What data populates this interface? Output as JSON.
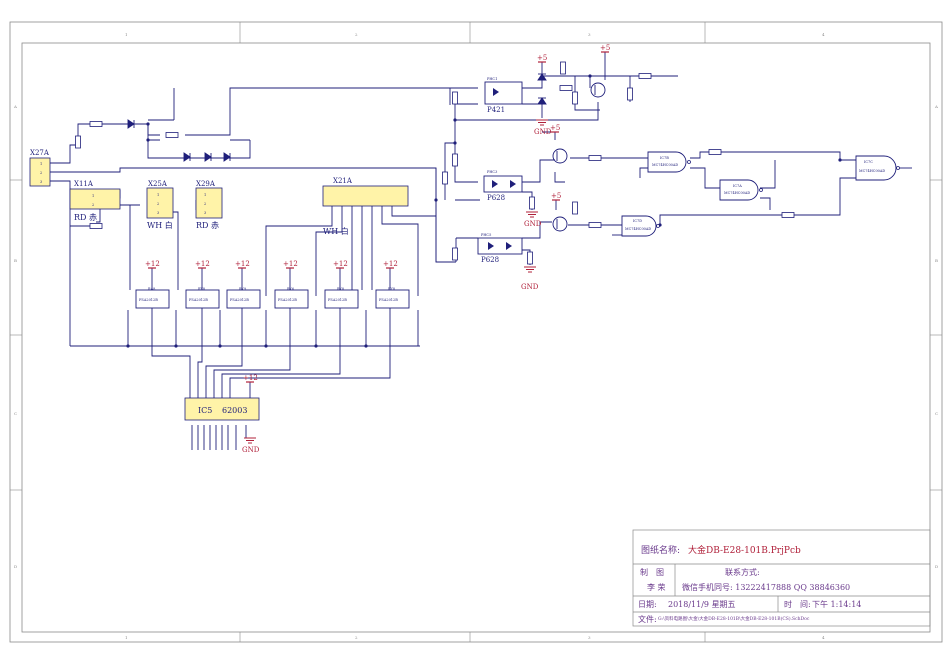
{
  "colors": {
    "wire": "#1f1f7a",
    "border": "#8a8a8a",
    "connector_fill": "#fff3a8",
    "power": "#b0203a",
    "titleblock_text": "#6a3a8c"
  },
  "border": {
    "columns": [
      "1",
      "2",
      "3",
      "4"
    ],
    "rows": [
      "A",
      "B",
      "C",
      "D"
    ]
  },
  "connectors": {
    "x27a": {
      "ref": "X27A",
      "pins": [
        "1",
        "2",
        "3"
      ]
    },
    "x11a": {
      "ref": "X11A",
      "pins": [
        "1",
        "2"
      ],
      "color": "RD 赤"
    },
    "x25a": {
      "ref": "X25A",
      "pins": [
        "1",
        "2",
        "3"
      ],
      "color": "WH 白"
    },
    "x29a": {
      "ref": "X29A",
      "pins": [
        "1",
        "2",
        "3"
      ],
      "color": "RD 赤"
    },
    "x21a": {
      "ref": "X21A",
      "color": "WH 白"
    }
  },
  "ic5": {
    "ref": "IC5",
    "part": "62003",
    "supply": "+12",
    "ground": "GND"
  },
  "power_labels": {
    "plus5": "+5",
    "plus12": "+12",
    "gnd": "GND"
  },
  "optocouplers": [
    {
      "ref": "PHC1",
      "part": "P421"
    },
    {
      "ref": "PHC3",
      "part": "P628"
    },
    {
      "ref": "PHC5",
      "part": "P628"
    }
  ],
  "relays": [
    {
      "ref": "RA8",
      "part": "FSA2012B"
    },
    {
      "ref": "RY8",
      "part": "FSA2012B"
    },
    {
      "ref": "RY9",
      "part": "FSA2012B"
    },
    {
      "ref": "RY6",
      "part": "FSA2012B"
    },
    {
      "ref": "RY8",
      "part": "FSA2012B"
    },
    {
      "ref": "RY8",
      "part": "FSA2012B"
    }
  ],
  "logic_gates": [
    {
      "ref": "IC7B",
      "part": "MC74HC00AD"
    },
    {
      "ref": "IC7A",
      "part": "MC74HC00AD"
    },
    {
      "ref": "IC7D",
      "part": "MC74HC00AD"
    },
    {
      "ref": "IC7C",
      "part": "MC74HC00AD"
    }
  ],
  "titleblock": {
    "drawing_name_label": "图纸名称:",
    "drawing_name": "大金DB-E28-101B.PrjPcb",
    "contact_label": "联系方式:",
    "drawn_label": "制　图",
    "drawer": "李 荣",
    "wechat": "微信手机同号: 13222417888 QQ 38846360",
    "date_label": "日期:",
    "date": "2018/11/9 星期五",
    "time_label": "时　间:",
    "time": "下午 1:14:14",
    "file_label": "文件:",
    "file_path": "G:\\资料电路图\\大金\\大金DB-E28-101B\\大金DB-E28-101B(CS).SchDoc"
  }
}
